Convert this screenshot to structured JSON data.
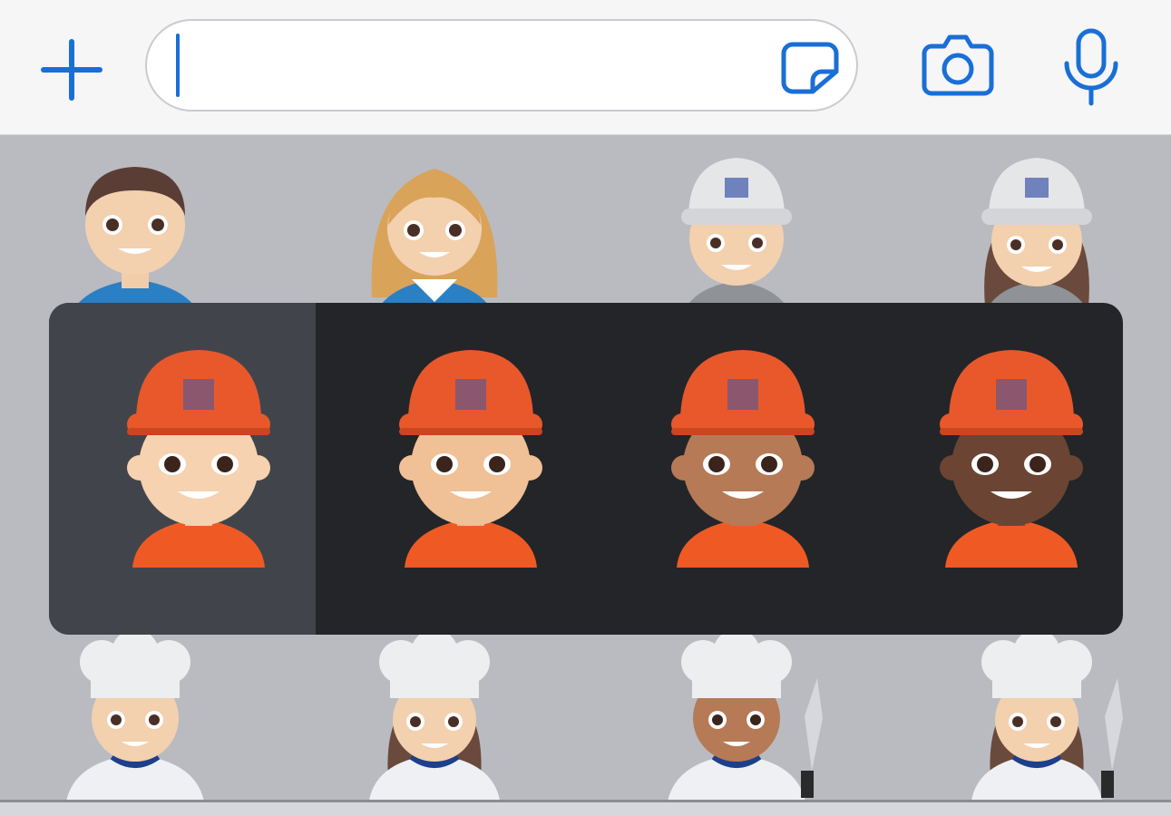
{
  "accent_color": "#1a6fd6",
  "input_bar": {
    "text_value": "",
    "icons": [
      "plus-icon",
      "sticker-icon",
      "camera-icon",
      "microphone-icon"
    ]
  },
  "emoji_grid": {
    "row1": [
      "office-worker-man",
      "office-worker-woman",
      "construction-worker-man-grey-helmet",
      "construction-worker-woman-grey-helmet"
    ],
    "row3": [
      "cook-man",
      "cook-woman",
      "cook-man-knife",
      "cook-woman-knife"
    ]
  },
  "skin_tone_popup": {
    "emoji": "construction-worker",
    "tones": [
      "light",
      "medium-light",
      "medium",
      "medium-dark"
    ],
    "selected_index": 0,
    "colors": {
      "helmet": "#e8582b",
      "shirt": "#ef5a24",
      "skin": [
        "#f6d2b0",
        "#f0c096",
        "#b67a57",
        "#6b4433"
      ]
    }
  }
}
